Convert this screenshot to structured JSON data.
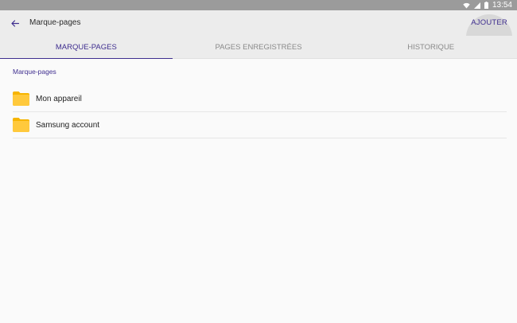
{
  "status_bar": {
    "time": "13:54",
    "icons": [
      "wifi-icon",
      "signal-icon",
      "battery-icon"
    ]
  },
  "app_bar": {
    "title": "Marque-pages",
    "add_label": "AJOUTER",
    "back_icon": "arrow-left-icon"
  },
  "tabs": [
    {
      "label": "MARQUE-PAGES",
      "active": true
    },
    {
      "label": "PAGES ENREGISTRÉES",
      "active": false
    },
    {
      "label": "HISTORIQUE",
      "active": false
    }
  ],
  "section": {
    "label": "Marque-pages"
  },
  "folders": [
    {
      "label": "Mon appareil",
      "icon": "folder-icon"
    },
    {
      "label": "Samsung account",
      "icon": "folder-icon"
    }
  ],
  "colors": {
    "accent": "#3f2e8f",
    "folder": "#ffc107",
    "status_bar": "#9b9b9b",
    "app_bar": "#ececec"
  }
}
